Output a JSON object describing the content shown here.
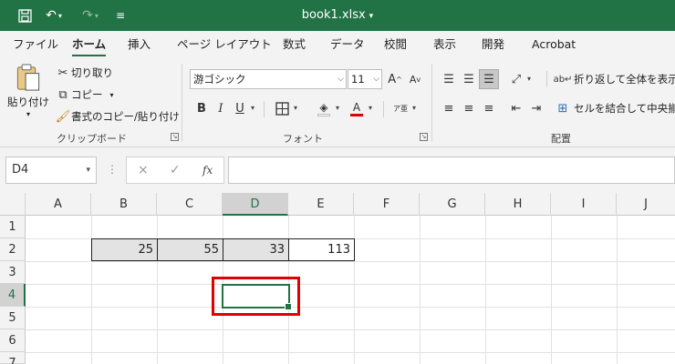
{
  "titlebar": {
    "filename": "book1.xlsx",
    "caret": "▾",
    "icons": [
      "save-icon",
      "undo-icon",
      "redo-icon",
      "customize-qat-icon"
    ]
  },
  "menu": {
    "tabs": [
      {
        "label": "ファイル"
      },
      {
        "label": "ホーム",
        "active": true
      },
      {
        "label": "挿入"
      },
      {
        "label": "ページ レイアウト"
      },
      {
        "label": "数式"
      },
      {
        "label": "データ"
      },
      {
        "label": "校閲"
      },
      {
        "label": "表示"
      },
      {
        "label": "開発"
      },
      {
        "label": "Acrobat"
      }
    ]
  },
  "ribbon": {
    "clipboard": {
      "paste_label": "貼り付け",
      "cut_label": "切り取り",
      "copy_label": "コピー",
      "format_painter_label": "書式のコピー/貼り付け",
      "group_label": "クリップボード"
    },
    "font": {
      "font_name": "游ゴシック",
      "font_size": "11",
      "group_label": "フォント",
      "bold": "B",
      "italic": "I",
      "underline": "U",
      "phonetic": "ア亜"
    },
    "alignment": {
      "wrap_text_label": "折り返して全体を表示す",
      "merge_center_label": "セルを結合して中央揃え",
      "group_label": "配置"
    }
  },
  "formula_bar": {
    "name_box": "D4",
    "cancel_icon": "×",
    "enter_icon": "✓",
    "fx_label": "fx",
    "formula": ""
  },
  "grid": {
    "columns": [
      "A",
      "B",
      "C",
      "D",
      "E",
      "F",
      "G",
      "H",
      "I",
      "J"
    ],
    "rows": [
      "1",
      "2",
      "3",
      "4",
      "5",
      "6",
      "7"
    ],
    "selected_cell": "D4",
    "cells": {
      "B2": "25",
      "C2": "55",
      "D2": "33",
      "E2": "113"
    }
  },
  "colors": {
    "accent": "#217346",
    "highlight_box": "#e00000",
    "shaded_cell": "#e3e3e3"
  }
}
